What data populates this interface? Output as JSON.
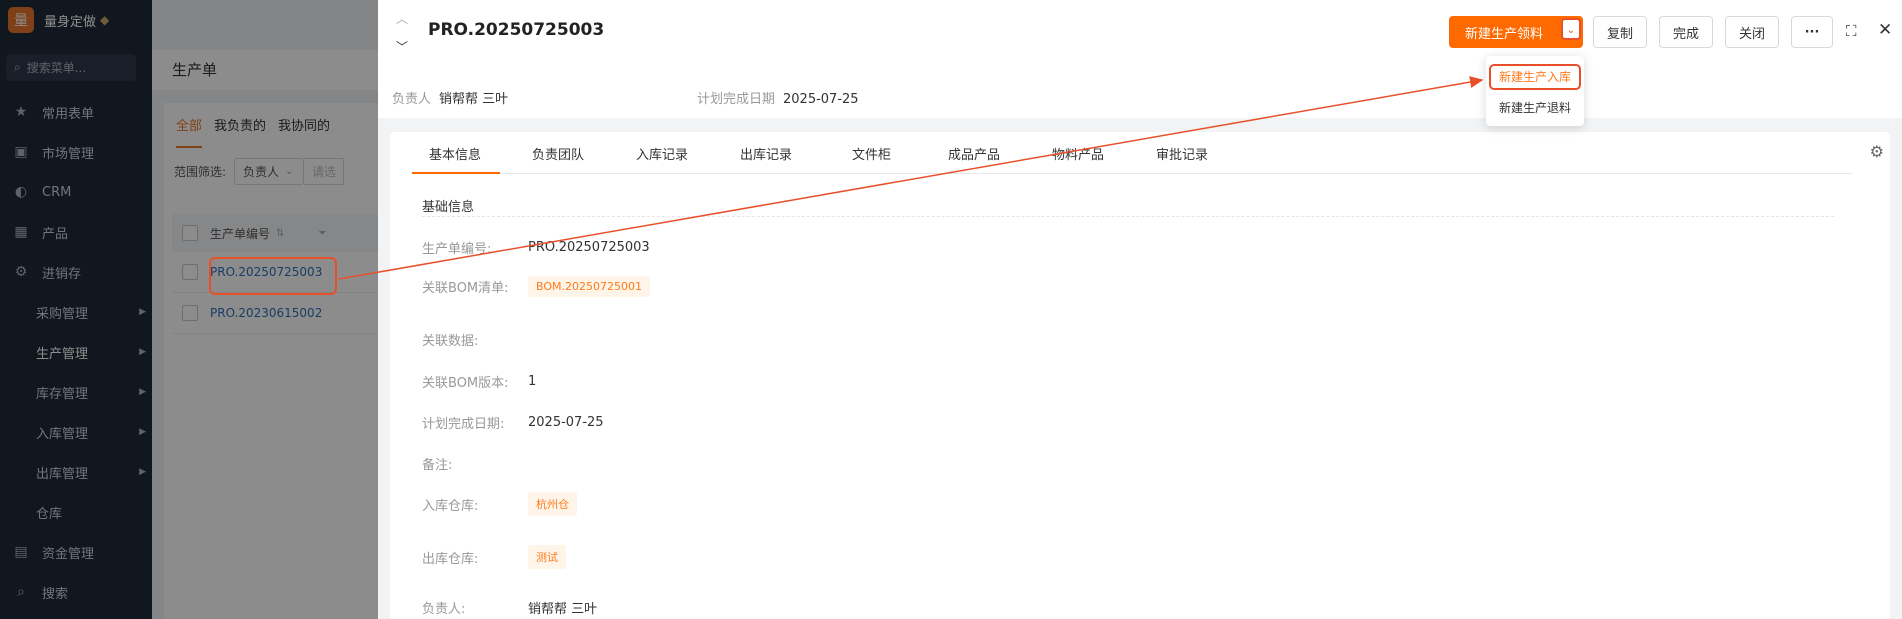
{
  "sidebar": {
    "logo_char": "量",
    "brand": "量身定做",
    "search_placeholder": "搜索菜单...",
    "items": [
      {
        "label": "常用表单",
        "icon": "★"
      },
      {
        "label": "市场管理",
        "icon": "▣"
      },
      {
        "label": "CRM",
        "icon": "◐"
      },
      {
        "label": "产品",
        "icon": "▦"
      },
      {
        "label": "进销存",
        "icon": "⚙"
      }
    ],
    "sub_items": [
      {
        "label": "采购管理"
      },
      {
        "label": "生产管理"
      },
      {
        "label": "库存管理"
      },
      {
        "label": "入库管理"
      },
      {
        "label": "出库管理"
      },
      {
        "label": "仓库"
      }
    ],
    "bottom_items": [
      {
        "label": "资金管理",
        "icon": "▤"
      },
      {
        "label": "搜索",
        "icon": "⌕"
      }
    ]
  },
  "list_page": {
    "title": "生产单",
    "tabs": [
      "全部",
      "我负责的",
      "我协同的"
    ],
    "filter_label": "范围筛选:",
    "filter_select": "负责人",
    "filter_placeholder": "请选",
    "column_header": "生产单编号",
    "rows": [
      "PRO.20250725003",
      "PRO.20230615002"
    ]
  },
  "drawer": {
    "title": "PRO.20250725003",
    "primary_button": "新建生产领料",
    "buttons": {
      "copy": "复制",
      "complete": "完成",
      "close": "关闭",
      "more": "···"
    },
    "dropdown": [
      "新建生产入库",
      "新建生产退料"
    ],
    "owner_label": "负责人",
    "owner_value": "销帮帮 三叶",
    "plan_label": "计划完成日期",
    "plan_value": "2025-07-25",
    "tabs": [
      "基本信息",
      "负责团队",
      "入库记录",
      "出库记录",
      "文件柜",
      "成品产品",
      "物料产品",
      "审批记录"
    ],
    "section_title": "基础信息",
    "fields": [
      {
        "label": "生产单编号:",
        "value": "PRO.20250725003"
      },
      {
        "label": "关联BOM清单:",
        "value": "BOM.20250725001"
      },
      {
        "label": "关联数据:",
        "value": ""
      },
      {
        "label": "关联BOM版本:",
        "value": "1"
      },
      {
        "label": "计划完成日期:",
        "value": "2025-07-25"
      },
      {
        "label": "备注:",
        "value": ""
      },
      {
        "label": "入库仓库:",
        "value": "杭州仓"
      },
      {
        "label": "出库仓库:",
        "value": "测试"
      },
      {
        "label": "负责人:",
        "value": "销帮帮 三叶"
      }
    ]
  },
  "colors": {
    "accent": "#ff6a00",
    "annotation": "#e8502a",
    "sidebar": "#1e2a38",
    "link": "#2f6fb8"
  }
}
